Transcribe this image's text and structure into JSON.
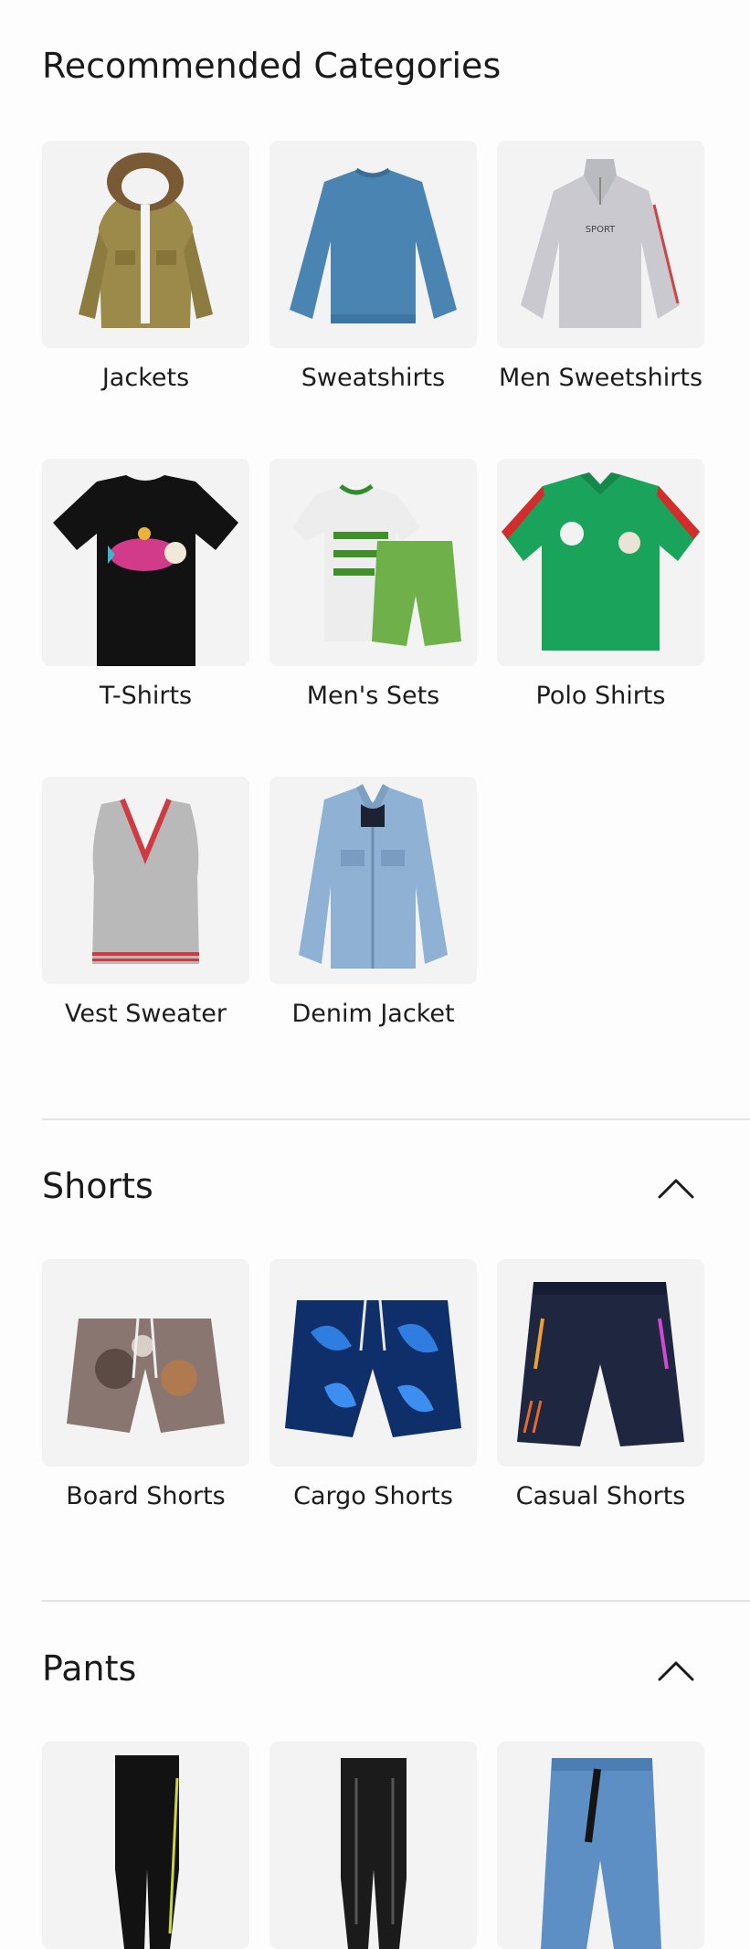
{
  "recommended": {
    "title": "Recommended Categories",
    "items": [
      {
        "label": "Jackets",
        "icon": "hooded-fur-jacket-image"
      },
      {
        "label": "Sweatshirts",
        "icon": "blue-sweatshirt-image"
      },
      {
        "label": "Men Sweetshirts",
        "icon": "grey-half-zip-sweatshirt-image"
      },
      {
        "label": "T-Shirts",
        "icon": "black-tshirt-image"
      },
      {
        "label": "Men's Sets",
        "icon": "tshirt-and-shorts-set-image"
      },
      {
        "label": "Polo Shirts",
        "icon": "green-polo-shirt-image"
      },
      {
        "label": "Vest Sweater",
        "icon": "grey-vest-sweater-image"
      },
      {
        "label": "Denim Jacket",
        "icon": "denim-jacket-image"
      }
    ]
  },
  "shorts": {
    "title": "Shorts",
    "toggle_icon": "chevron-up-icon",
    "items": [
      {
        "label": "Board Shorts",
        "icon": "floral-board-shorts-image"
      },
      {
        "label": "Cargo Shorts",
        "icon": "blue-leaf-cargo-shorts-image"
      },
      {
        "label": "Casual Shorts",
        "icon": "navy-casual-shorts-image"
      }
    ]
  },
  "pants": {
    "title": "Pants",
    "toggle_icon": "chevron-up-icon",
    "items": [
      {
        "icon": "black-sport-leggings-image"
      },
      {
        "icon": "black-leather-pants-image"
      },
      {
        "icon": "blue-denim-pants-image"
      }
    ]
  },
  "colors": {
    "tile_bg": "#f3f3f3",
    "divider": "#e3e3e3",
    "text": "#1c1c1c"
  }
}
